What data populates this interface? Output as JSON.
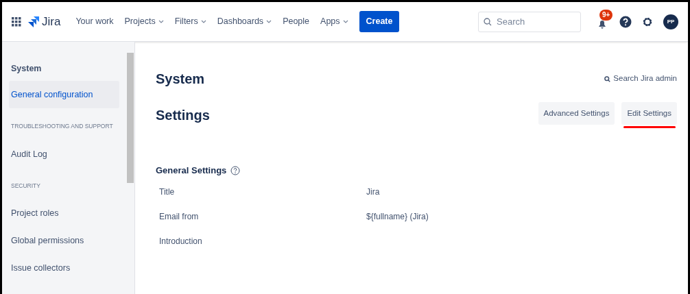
{
  "nav": {
    "product": "Jira",
    "items": [
      {
        "label": "Your work",
        "dropdown": false
      },
      {
        "label": "Projects",
        "dropdown": true
      },
      {
        "label": "Filters",
        "dropdown": true
      },
      {
        "label": "Dashboards",
        "dropdown": true
      },
      {
        "label": "People",
        "dropdown": false
      },
      {
        "label": "Apps",
        "dropdown": true
      }
    ],
    "create": "Create",
    "search": {
      "placeholder": "Search"
    },
    "notification_badge": "9+",
    "avatar": "PP"
  },
  "sidebar": {
    "items": [
      {
        "kind": "heading",
        "label": "System",
        "selected": false
      },
      {
        "kind": "link",
        "label": "General configuration",
        "selected": true
      },
      {
        "kind": "section",
        "label": "TROUBLESHOOTING AND SUPPORT",
        "selected": false
      },
      {
        "kind": "link",
        "label": "Audit Log",
        "selected": false
      },
      {
        "kind": "section",
        "label": "SECURITY",
        "selected": false
      },
      {
        "kind": "link",
        "label": "Project roles",
        "selected": false
      },
      {
        "kind": "link",
        "label": "Global permissions",
        "selected": false
      },
      {
        "kind": "link",
        "label": "Issue collectors",
        "selected": false
      }
    ]
  },
  "page": {
    "title": "System",
    "search_admin": "Search Jira admin",
    "subtitle": "Settings",
    "buttons": [
      {
        "label": "Advanced Settings",
        "underlined": false
      },
      {
        "label": "Edit Settings",
        "underlined": true
      }
    ],
    "section_title": "General Settings",
    "rows": [
      {
        "label": "Title",
        "value": "Jira"
      },
      {
        "label": "Email from",
        "value": "${fullname} (Jira)"
      },
      {
        "label": "Introduction"
      }
    ]
  }
}
